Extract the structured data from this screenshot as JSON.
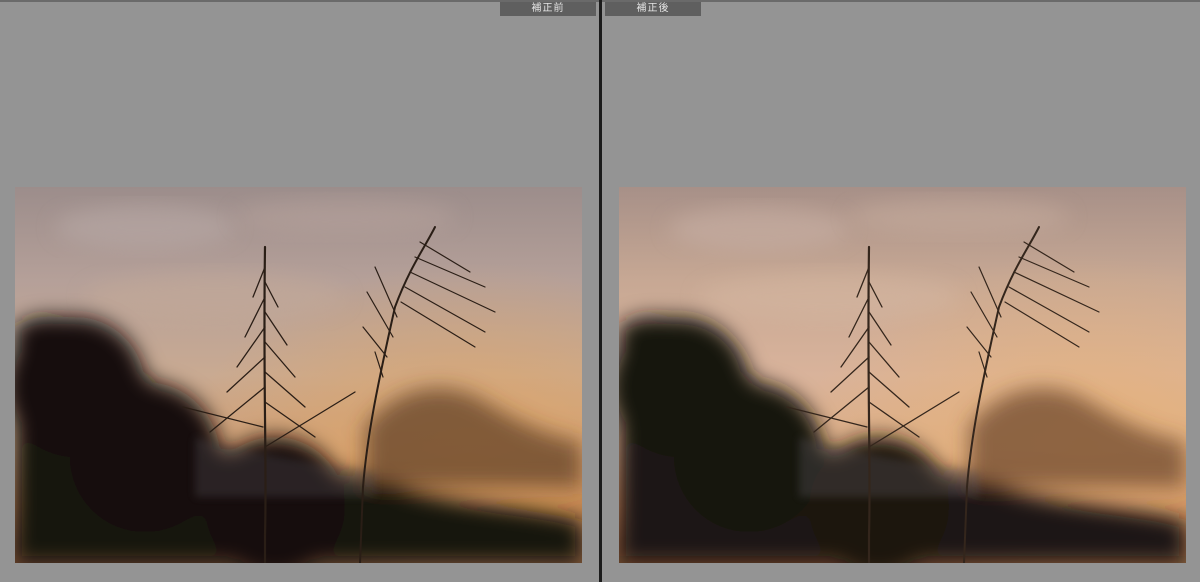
{
  "compare_view": {
    "before_label": "補正前",
    "after_label": "補正後"
  },
  "colors": {
    "background": "#949494",
    "divider": "#1b1b1b",
    "label_bg": "#5f5f5f",
    "label_text": "#e6e6e6"
  },
  "icons": {
    "before_photo": "sunset-silver-grass-photo",
    "after_photo": "sunset-silver-grass-photo"
  }
}
